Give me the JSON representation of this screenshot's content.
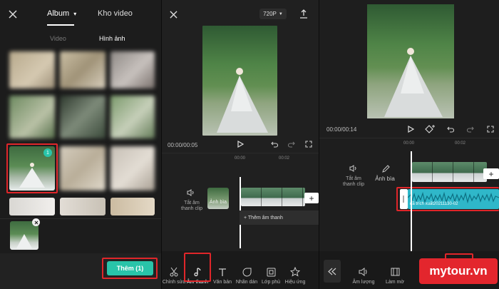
{
  "gallery": {
    "tab_album": "Album",
    "tab_kho_video": "Kho video",
    "sub_video": "Video",
    "sub_hinh_anh": "Hình ảnh",
    "selected_badge": "1",
    "add_button": "Thêm (1)"
  },
  "editor": {
    "resolution": "720P",
    "timecode": "00:00/00:05",
    "tick_0": "00:00",
    "tick_1": "00:02",
    "mute_label": "Tắt âm thanh clip",
    "cover_label": "Ảnh bìa",
    "add_audio": "+ Thêm âm thanh",
    "toolbar": [
      {
        "label": "Chỉnh sửa"
      },
      {
        "label": "Âm thanh"
      },
      {
        "label": "Văn bản"
      },
      {
        "label": "Nhãn dán"
      },
      {
        "label": "Lớp phủ"
      },
      {
        "label": "Hiệu ứng"
      }
    ]
  },
  "audio_editor": {
    "timecode": "00:00/00:14",
    "tick_0": "00:00",
    "tick_1": "00:02",
    "mute_label": "Tắt âm thanh clip",
    "cover_label": "Ảnh bìa",
    "audio_clip_name": "đã trích xuất20211130-02",
    "toolbar": [
      {
        "label": "Âm lượng"
      },
      {
        "label": "Làm mờ"
      }
    ]
  },
  "watermark": {
    "brand": "mytour.vn"
  },
  "colors": {
    "accent": "#29c4a9",
    "highlight": "#e0262a",
    "waveform": "#2fb7c9"
  }
}
